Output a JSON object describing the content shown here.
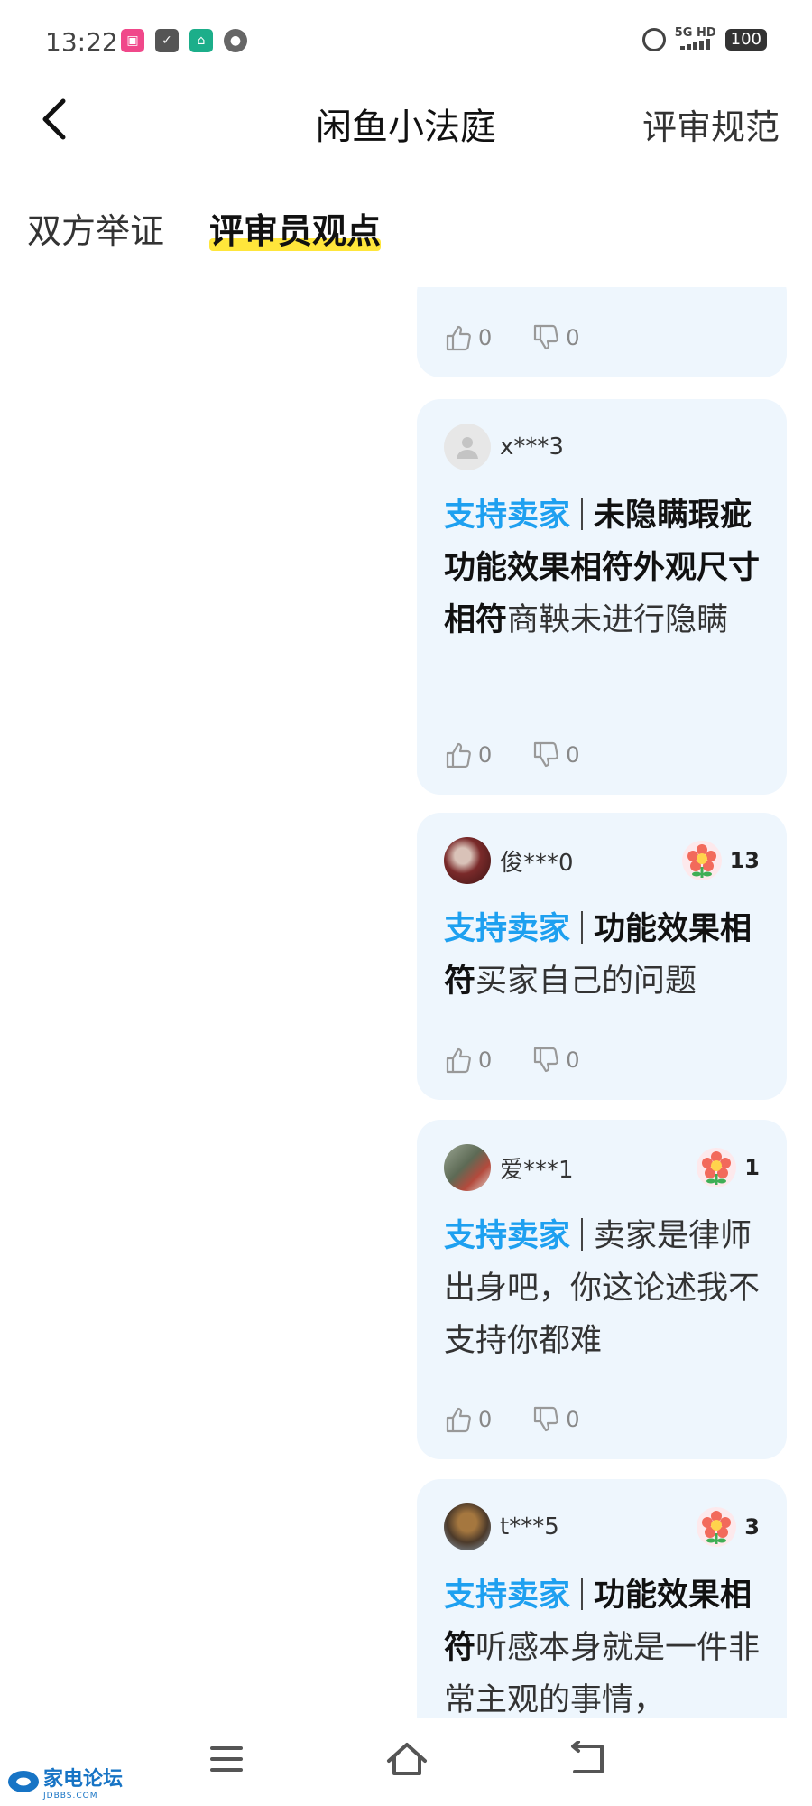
{
  "status_bar": {
    "time": "13:22",
    "network": "5G HD",
    "battery": "100"
  },
  "header": {
    "title": "闲鱼小法庭",
    "rules_link": "评审规范"
  },
  "tabs": [
    {
      "label": "双方举证",
      "active": false
    },
    {
      "label": "评审员观点",
      "active": true
    }
  ],
  "top_card": {
    "likes": "0",
    "dislikes": "0"
  },
  "comments": [
    {
      "username": "x***3",
      "has_flowers": false,
      "flowers": "",
      "stance": "支持卖家",
      "tags": "未隐瞒瑕疵功能效果相符外观尺寸相符",
      "text": "商鞅未进行隐瞒",
      "likes": "0",
      "dislikes": "0"
    },
    {
      "username": "俊***0",
      "has_flowers": true,
      "flowers": "13",
      "stance": "支持卖家",
      "tags": "功能效果相符",
      "text": "买家自己的问题",
      "likes": "0",
      "dislikes": "0"
    },
    {
      "username": "爱***1",
      "has_flowers": true,
      "flowers": "1",
      "stance": "支持卖家",
      "tags": "",
      "text": "卖家是律师出身吧，你这论述我不支持你都难",
      "likes": "0",
      "dislikes": "0"
    },
    {
      "username": "t***5",
      "has_flowers": true,
      "flowers": "3",
      "stance": "支持卖家",
      "tags": "功能效果相符",
      "text": "听感本身就是一件非常主观的事情，",
      "likes": "",
      "dislikes": ""
    }
  ],
  "watermark": {
    "text": "家电论坛",
    "sub": "JDBBS.COM"
  },
  "colors": {
    "accent_blue": "#1ea0f0",
    "card_bg": "#eef6fd",
    "tab_highlight": "#ffe63b"
  }
}
